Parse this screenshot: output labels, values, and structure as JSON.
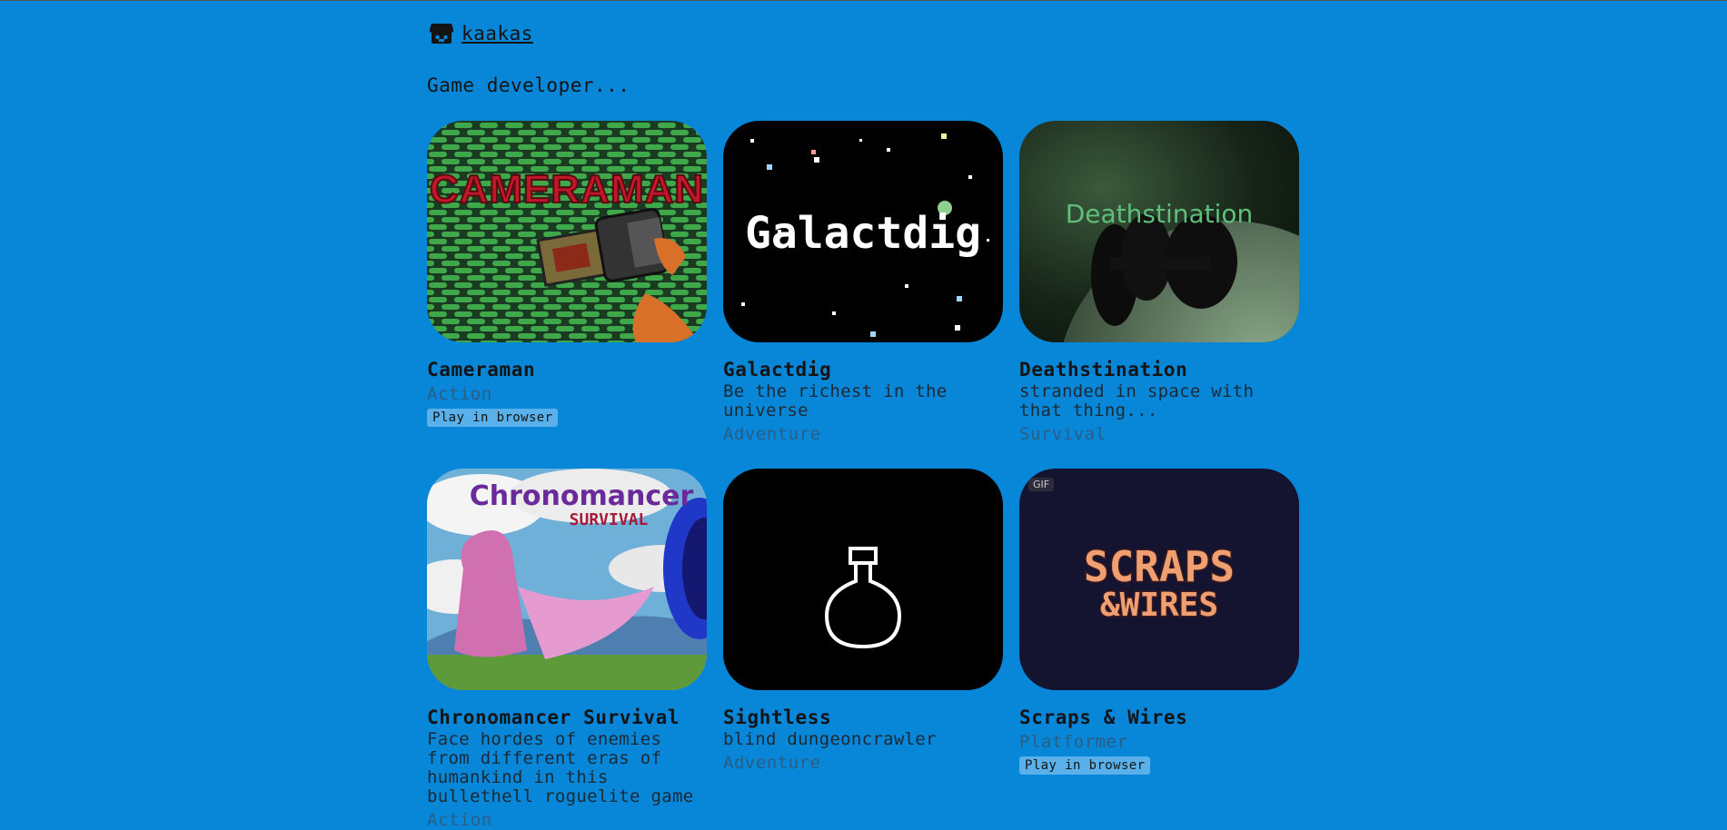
{
  "header": {
    "username": "kaakas",
    "tagline": "Game developer..."
  },
  "colors": {
    "background": "#0886d8",
    "play_badge": "#5ab0ea",
    "genre_text": "#2a5e86"
  },
  "games": [
    {
      "title": "Cameraman",
      "description": "",
      "genre": "Action",
      "badge": "Play in browser",
      "cover_text": "CAMERAMAN"
    },
    {
      "title": "Galactdig",
      "description": "Be the richest in the universe",
      "genre": "Adventure",
      "badge": "",
      "cover_text": "Galactdig"
    },
    {
      "title": "Deathstination",
      "description": "stranded in space with that thing...",
      "genre": "Survival",
      "badge": "",
      "cover_text": "Deathstination"
    },
    {
      "title": "Chronomancer Survival",
      "description": "Face hordes of enemies from different eras of humankind in this bullethell roguelite game",
      "genre": "Action",
      "badge": "",
      "cover_text": "Chronomancer",
      "cover_subtext": "SURVIVAL"
    },
    {
      "title": "Sightless",
      "description": "blind dungeoncrawler",
      "genre": "Adventure",
      "badge": "",
      "cover_text": ""
    },
    {
      "title": "Scraps & Wires",
      "description": "",
      "genre": "Platformer",
      "badge": "Play in browser",
      "gif_label": "GIF",
      "cover_text": "SCRAPS",
      "cover_subtext": "&WIRES"
    }
  ]
}
